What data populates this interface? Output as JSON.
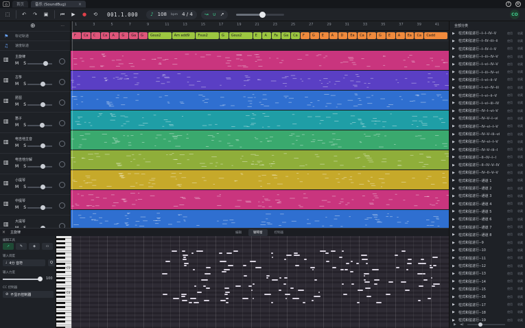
{
  "titlebar": {
    "logo": "⌂",
    "tabs": [
      {
        "label": "首页",
        "active": false
      },
      {
        "label": "音乐 (SoundBug)",
        "active": true
      }
    ],
    "help": "?",
    "settings": "⚙"
  },
  "toolbar": {
    "time": "001.1.000",
    "metronome": "♪",
    "bpm": "108",
    "bpm_unit": "bpm",
    "time_signature": "4 / 4",
    "volume": 0.55,
    "account": "CO"
  },
  "track_header": {
    "add": "⊕",
    "more": "···",
    "marker_label": "标记轨道",
    "tempo_label": "速度轨道"
  },
  "tracks": [
    {
      "name": "主旋律",
      "color": "#c9357e",
      "vol": 0.72
    },
    {
      "name": "古筝",
      "color": "#5a3fc4",
      "vol": 0.62
    },
    {
      "name": "琵琶",
      "color": "#2f6fd0",
      "vol": 0.6
    },
    {
      "name": "笛子",
      "color": "#1f9ea6",
      "vol": 0.58
    },
    {
      "name": "电吉他主音",
      "color": "#3aa96e",
      "vol": 0.62
    },
    {
      "name": "电吉他分解",
      "color": "#8fae3a",
      "vol": 0.6
    },
    {
      "name": "小提琴",
      "color": "#c6a92a",
      "vol": 0.62
    },
    {
      "name": "中提琴",
      "color": "#c9357e",
      "vol": 0.62
    },
    {
      "name": "大提琴",
      "color": "#2f6fd0",
      "vol": 0.6
    }
  ],
  "ruler": [
    "1",
    "3",
    "5",
    "7",
    "9",
    "11",
    "13",
    "15",
    "17",
    "19",
    "21",
    "23",
    "25",
    "27",
    "29",
    "31",
    "33",
    "35",
    "37",
    "39",
    "41"
  ],
  "chords": [
    {
      "label": "F",
      "color": "#e0557a"
    },
    {
      "label": "Ca",
      "color": "#e0557a"
    },
    {
      "label": "C",
      "color": "#e0557a"
    },
    {
      "label": "Ca",
      "color": "#e0557a"
    },
    {
      "label": "A",
      "color": "#e0557a"
    },
    {
      "label": "G",
      "color": "#e0557a"
    },
    {
      "label": "Ga",
      "color": "#e0557a"
    },
    {
      "label": "G",
      "color": "#e0557a"
    },
    {
      "label": "Gsus2",
      "color": "#9cc640"
    },
    {
      "label": "Am add9",
      "color": "#9cc640"
    },
    {
      "label": "Fsus2",
      "color": "#9cc640"
    },
    {
      "label": "G",
      "color": "#9cc640"
    },
    {
      "label": "Gsus2",
      "color": "#9cc640"
    },
    {
      "label": "E",
      "color": "#9cc640"
    },
    {
      "label": "A",
      "color": "#9cc640"
    },
    {
      "label": "Fa",
      "color": "#9cc640"
    },
    {
      "label": "Ga",
      "color": "#9cc640"
    },
    {
      "label": "Ca",
      "color": "#9cc640"
    },
    {
      "label": "F",
      "color": "#f08a3c"
    },
    {
      "label": "G",
      "color": "#f08a3c"
    },
    {
      "label": "E",
      "color": "#f08a3c"
    },
    {
      "label": "A",
      "color": "#f08a3c"
    },
    {
      "label": "D",
      "color": "#f08a3c"
    },
    {
      "label": "Ea",
      "color": "#f08a3c"
    },
    {
      "label": "Ca",
      "color": "#f08a3c"
    },
    {
      "label": "F",
      "color": "#f08a3c"
    },
    {
      "label": "G",
      "color": "#f08a3c"
    },
    {
      "label": "E",
      "color": "#f08a3c"
    },
    {
      "label": "A",
      "color": "#f08a3c"
    },
    {
      "label": "Ea",
      "color": "#f08a3c"
    },
    {
      "label": "Ca",
      "color": "#f08a3c"
    },
    {
      "label": "Cadd",
      "color": "#f08a3c"
    }
  ],
  "sidebar": {
    "title": "全部分类",
    "action_a": "使用",
    "action_b": "收藏",
    "items": [
      "柱式和弦进行--I--I--IV--V",
      "柱式和弦进行--I--IV--iii--ii",
      "柱式和弦进行--I--IV--I--V",
      "柱式和弦进行--I--iii--IV--V",
      "柱式和弦进行--I--vi--IV--V",
      "柱式和弦进行--I--iii--IV--vi",
      "柱式和弦进行--I--vi--ii--V",
      "柱式和弦进行--I--vi--IV--iii",
      "柱式和弦进行--I--vi--ii--V",
      "柱式和弦进行--I--vi--iii--IV",
      "柱式和弦进行--IV--I--vi--V",
      "柱式和弦进行--IV--V--I--vi",
      "柱式和弦进行--IV--vi--I--V",
      "柱式和弦进行--IV--V--iii--vi",
      "柱式和弦进行--IV--vi--I--V",
      "柱式和弦进行--IV--V--iii--I",
      "柱式和弦进行--II--IV--I--I",
      "柱式和弦进行--II--IV--V--IV",
      "柱式和弦进行--IV--II--V--V",
      "柱式和弦进行--通道 1",
      "柱式和弦进行--通道 2",
      "柱式和弦进行--通道 3",
      "柱式和弦进行--通道 4",
      "柱式和弦进行--通道 5",
      "柱式和弦进行--通道 6",
      "柱式和弦进行--通道 7",
      "柱式和弦进行--通道 8",
      "柱式和弦进行--9",
      "柱式和弦进行--10",
      "柱式和弦进行--11",
      "柱式和弦进行--12",
      "柱式和弦进行--13",
      "柱式和弦进行--14",
      "柱式和弦进行--15",
      "柱式和弦进行--16",
      "柱式和弦进行--17",
      "柱式和弦进行--18",
      "柱式和弦进行--19"
    ]
  },
  "editor": {
    "close": "×",
    "track_name": "主旋律",
    "tabs": [
      {
        "label": "编辑",
        "active": false
      },
      {
        "label": "钢琴窗",
        "active": true
      },
      {
        "label": "控制器",
        "active": false
      }
    ],
    "tools_label": "编辑工具",
    "input_label": "输入调度",
    "quantize_value": "4分 音符",
    "quantize_btn": "Q",
    "velocity_label": "输入力度",
    "velocity_value": "100",
    "velocity_fraction": 1.0,
    "cc_label": "CC 控制器",
    "cc_value": "不显示控制器",
    "octave_labels": [
      "C5",
      "C4"
    ]
  }
}
